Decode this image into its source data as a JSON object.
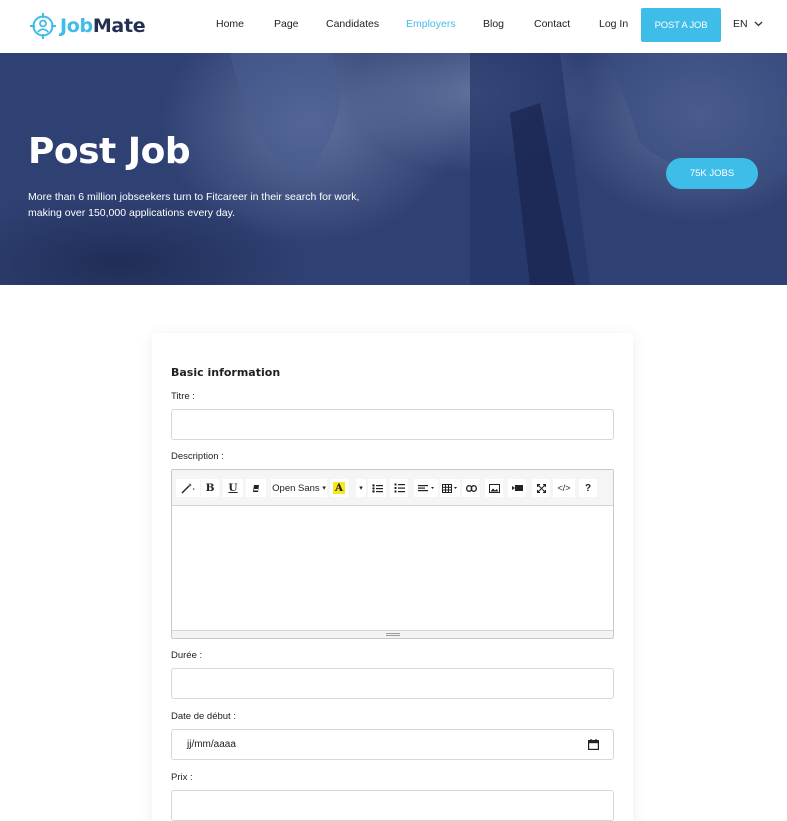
{
  "header": {
    "logo": {
      "part1": "Job",
      "part2": "Mate"
    },
    "nav": [
      {
        "label": "Home",
        "active": false
      },
      {
        "label": "Page",
        "active": false
      },
      {
        "label": "Candidates",
        "active": false
      },
      {
        "label": "Employers",
        "active": true
      },
      {
        "label": "Blog",
        "active": false
      },
      {
        "label": "Contact",
        "active": false
      },
      {
        "label": "Log In",
        "active": false
      }
    ],
    "post_button": "POST A JOB",
    "language": "EN",
    "language_icon": "chevron-down-icon"
  },
  "hero": {
    "title": "Post Job",
    "subtitle": "More than 6 million jobseekers turn to Fitcareer in their search for work, making over 150,000 applications every day.",
    "jobs_pill": "75K JOBS"
  },
  "form": {
    "section_title": "Basic information",
    "fields": {
      "titre": {
        "label": "Titre :",
        "value": ""
      },
      "description": {
        "label": "Description :"
      },
      "duree": {
        "label": "Durée :",
        "value": ""
      },
      "date_debut": {
        "label": "Date de début :",
        "placeholder": "jj/mm/aaaa"
      },
      "prix": {
        "label": "Prix :",
        "value": ""
      }
    },
    "editor": {
      "font_name": "Open Sans",
      "font_caret": "▾",
      "buttons": [
        {
          "icon": "magic-wand-icon"
        },
        {
          "icon": "bold-icon",
          "text": "B"
        },
        {
          "icon": "underline-icon",
          "text": "U"
        },
        {
          "icon": "eraser-icon"
        },
        {
          "icon": "font-family-dropdown"
        },
        {
          "icon": "text-color-icon",
          "text": "A"
        },
        {
          "icon": "unordered-list-icon"
        },
        {
          "icon": "ordered-list-icon"
        },
        {
          "icon": "paragraph-align-icon"
        },
        {
          "icon": "table-icon"
        },
        {
          "icon": "link-icon"
        },
        {
          "icon": "picture-icon"
        },
        {
          "icon": "video-icon"
        },
        {
          "icon": "fullscreen-icon"
        },
        {
          "icon": "code-view-icon",
          "text": "</>"
        },
        {
          "icon": "help-icon",
          "text": "?"
        }
      ]
    }
  },
  "colors": {
    "accent": "#3fbde9",
    "hero_overlay": "#2c3d6e",
    "logo_dark": "#23304f",
    "text_highlight": "#f6e81b"
  }
}
